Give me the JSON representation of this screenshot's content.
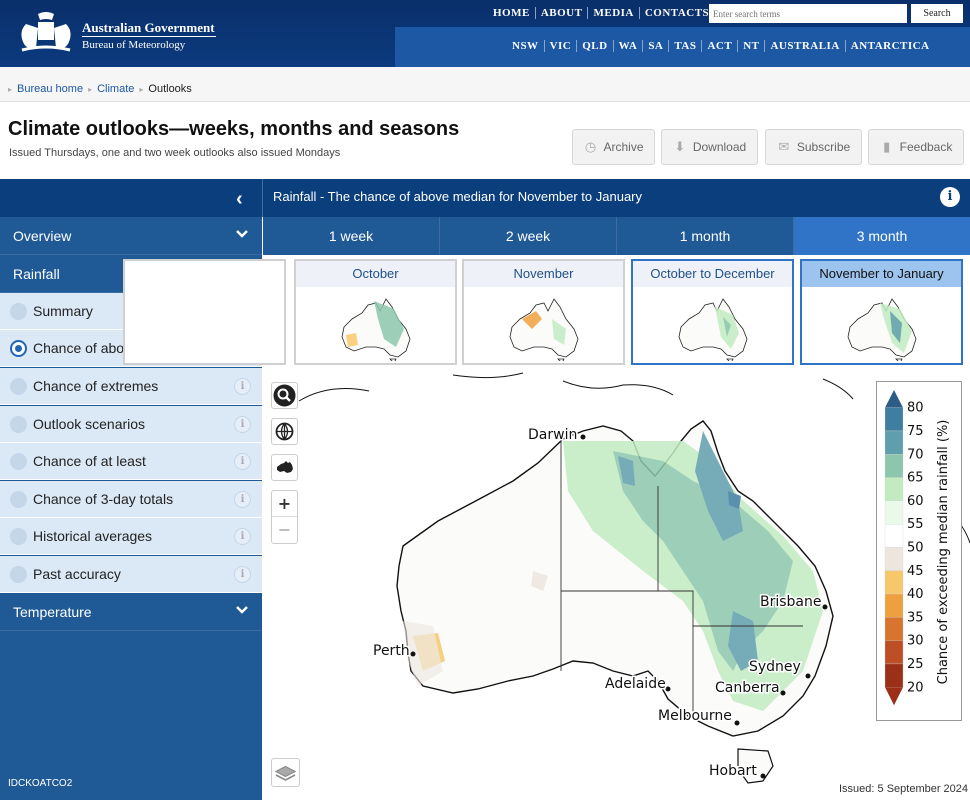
{
  "header": {
    "org_line1": "Australian Government",
    "org_line2": "Bureau of Meteorology",
    "top_nav": [
      "HOME",
      "ABOUT",
      "MEDIA",
      "CONTACTS"
    ],
    "search_placeholder": "Enter search terms",
    "search_button": "Search",
    "region_nav": [
      "NSW",
      "VIC",
      "QLD",
      "WA",
      "SA",
      "TAS",
      "ACT",
      "NT",
      "AUSTRALIA",
      "ANTARCTICA"
    ]
  },
  "breadcrumb": [
    "Bureau home",
    "Climate",
    "Outlooks"
  ],
  "page": {
    "title": "Climate outlooks—weeks, months and seasons",
    "subtitle": "Issued Thursdays, one and two week outlooks also issued Mondays",
    "actions": [
      {
        "label": "Archive",
        "icon": "clock-icon"
      },
      {
        "label": "Download",
        "icon": "download-icon"
      },
      {
        "label": "Subscribe",
        "icon": "mail-icon"
      },
      {
        "label": "Feedback",
        "icon": "comment-icon"
      }
    ]
  },
  "map_title": "Rainfall - The chance of above median for November to January",
  "sidebar": {
    "sections": [
      "Overview",
      "Rainfall",
      "Temperature"
    ],
    "rainfall_items": [
      "Summary",
      "Chance of above median",
      "Chance of extremes",
      "Outlook scenarios",
      "Chance of at least",
      "Chance of 3-day totals",
      "Historical averages",
      "Past accuracy"
    ],
    "selected_item": "Chance of above median",
    "product_code": "IDCKOATCO2"
  },
  "tabs": [
    "1 week",
    "2 week",
    "1 month",
    "3 month"
  ],
  "active_tab": "3 month",
  "thumbnails": [
    "October",
    "November",
    "October to December",
    "November to January"
  ],
  "active_thumbnail": "November to January",
  "map": {
    "cities": [
      "Darwin",
      "Brisbane",
      "Perth",
      "Sydney",
      "Adelaide",
      "Canberra",
      "Melbourne",
      "Hobart"
    ],
    "legend_title": "Chance of exceeding median rainfall (%)",
    "legend_values": [
      "80",
      "75",
      "70",
      "65",
      "60",
      "55",
      "50",
      "45",
      "40",
      "35",
      "30",
      "25",
      "20"
    ],
    "legend_colors": [
      "#2d5d86",
      "#3f7ea0",
      "#5f9fad",
      "#8cc7ad",
      "#c2ebc2",
      "#eafaea",
      "#ffffff",
      "#ece6df",
      "#f7c86b",
      "#eea03f",
      "#d8742d",
      "#be4e25",
      "#9c2f17"
    ],
    "issued": "Issued: 5 September 2024"
  }
}
